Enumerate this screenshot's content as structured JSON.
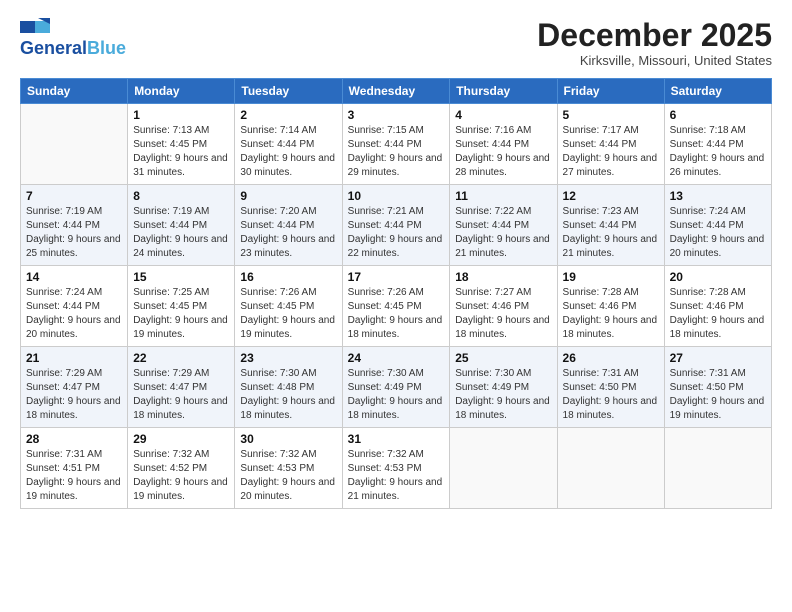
{
  "header": {
    "logo_line1": "General",
    "logo_line2": "Blue",
    "month": "December 2025",
    "location": "Kirksville, Missouri, United States"
  },
  "days_of_week": [
    "Sunday",
    "Monday",
    "Tuesday",
    "Wednesday",
    "Thursday",
    "Friday",
    "Saturday"
  ],
  "weeks": [
    [
      {
        "num": "",
        "sunrise": "",
        "sunset": "",
        "daylight": ""
      },
      {
        "num": "1",
        "sunrise": "Sunrise: 7:13 AM",
        "sunset": "Sunset: 4:45 PM",
        "daylight": "Daylight: 9 hours and 31 minutes."
      },
      {
        "num": "2",
        "sunrise": "Sunrise: 7:14 AM",
        "sunset": "Sunset: 4:44 PM",
        "daylight": "Daylight: 9 hours and 30 minutes."
      },
      {
        "num": "3",
        "sunrise": "Sunrise: 7:15 AM",
        "sunset": "Sunset: 4:44 PM",
        "daylight": "Daylight: 9 hours and 29 minutes."
      },
      {
        "num": "4",
        "sunrise": "Sunrise: 7:16 AM",
        "sunset": "Sunset: 4:44 PM",
        "daylight": "Daylight: 9 hours and 28 minutes."
      },
      {
        "num": "5",
        "sunrise": "Sunrise: 7:17 AM",
        "sunset": "Sunset: 4:44 PM",
        "daylight": "Daylight: 9 hours and 27 minutes."
      },
      {
        "num": "6",
        "sunrise": "Sunrise: 7:18 AM",
        "sunset": "Sunset: 4:44 PM",
        "daylight": "Daylight: 9 hours and 26 minutes."
      }
    ],
    [
      {
        "num": "7",
        "sunrise": "Sunrise: 7:19 AM",
        "sunset": "Sunset: 4:44 PM",
        "daylight": "Daylight: 9 hours and 25 minutes."
      },
      {
        "num": "8",
        "sunrise": "Sunrise: 7:19 AM",
        "sunset": "Sunset: 4:44 PM",
        "daylight": "Daylight: 9 hours and 24 minutes."
      },
      {
        "num": "9",
        "sunrise": "Sunrise: 7:20 AM",
        "sunset": "Sunset: 4:44 PM",
        "daylight": "Daylight: 9 hours and 23 minutes."
      },
      {
        "num": "10",
        "sunrise": "Sunrise: 7:21 AM",
        "sunset": "Sunset: 4:44 PM",
        "daylight": "Daylight: 9 hours and 22 minutes."
      },
      {
        "num": "11",
        "sunrise": "Sunrise: 7:22 AM",
        "sunset": "Sunset: 4:44 PM",
        "daylight": "Daylight: 9 hours and 21 minutes."
      },
      {
        "num": "12",
        "sunrise": "Sunrise: 7:23 AM",
        "sunset": "Sunset: 4:44 PM",
        "daylight": "Daylight: 9 hours and 21 minutes."
      },
      {
        "num": "13",
        "sunrise": "Sunrise: 7:24 AM",
        "sunset": "Sunset: 4:44 PM",
        "daylight": "Daylight: 9 hours and 20 minutes."
      }
    ],
    [
      {
        "num": "14",
        "sunrise": "Sunrise: 7:24 AM",
        "sunset": "Sunset: 4:44 PM",
        "daylight": "Daylight: 9 hours and 20 minutes."
      },
      {
        "num": "15",
        "sunrise": "Sunrise: 7:25 AM",
        "sunset": "Sunset: 4:45 PM",
        "daylight": "Daylight: 9 hours and 19 minutes."
      },
      {
        "num": "16",
        "sunrise": "Sunrise: 7:26 AM",
        "sunset": "Sunset: 4:45 PM",
        "daylight": "Daylight: 9 hours and 19 minutes."
      },
      {
        "num": "17",
        "sunrise": "Sunrise: 7:26 AM",
        "sunset": "Sunset: 4:45 PM",
        "daylight": "Daylight: 9 hours and 18 minutes."
      },
      {
        "num": "18",
        "sunrise": "Sunrise: 7:27 AM",
        "sunset": "Sunset: 4:46 PM",
        "daylight": "Daylight: 9 hours and 18 minutes."
      },
      {
        "num": "19",
        "sunrise": "Sunrise: 7:28 AM",
        "sunset": "Sunset: 4:46 PM",
        "daylight": "Daylight: 9 hours and 18 minutes."
      },
      {
        "num": "20",
        "sunrise": "Sunrise: 7:28 AM",
        "sunset": "Sunset: 4:46 PM",
        "daylight": "Daylight: 9 hours and 18 minutes."
      }
    ],
    [
      {
        "num": "21",
        "sunrise": "Sunrise: 7:29 AM",
        "sunset": "Sunset: 4:47 PM",
        "daylight": "Daylight: 9 hours and 18 minutes."
      },
      {
        "num": "22",
        "sunrise": "Sunrise: 7:29 AM",
        "sunset": "Sunset: 4:47 PM",
        "daylight": "Daylight: 9 hours and 18 minutes."
      },
      {
        "num": "23",
        "sunrise": "Sunrise: 7:30 AM",
        "sunset": "Sunset: 4:48 PM",
        "daylight": "Daylight: 9 hours and 18 minutes."
      },
      {
        "num": "24",
        "sunrise": "Sunrise: 7:30 AM",
        "sunset": "Sunset: 4:49 PM",
        "daylight": "Daylight: 9 hours and 18 minutes."
      },
      {
        "num": "25",
        "sunrise": "Sunrise: 7:30 AM",
        "sunset": "Sunset: 4:49 PM",
        "daylight": "Daylight: 9 hours and 18 minutes."
      },
      {
        "num": "26",
        "sunrise": "Sunrise: 7:31 AM",
        "sunset": "Sunset: 4:50 PM",
        "daylight": "Daylight: 9 hours and 18 minutes."
      },
      {
        "num": "27",
        "sunrise": "Sunrise: 7:31 AM",
        "sunset": "Sunset: 4:50 PM",
        "daylight": "Daylight: 9 hours and 19 minutes."
      }
    ],
    [
      {
        "num": "28",
        "sunrise": "Sunrise: 7:31 AM",
        "sunset": "Sunset: 4:51 PM",
        "daylight": "Daylight: 9 hours and 19 minutes."
      },
      {
        "num": "29",
        "sunrise": "Sunrise: 7:32 AM",
        "sunset": "Sunset: 4:52 PM",
        "daylight": "Daylight: 9 hours and 19 minutes."
      },
      {
        "num": "30",
        "sunrise": "Sunrise: 7:32 AM",
        "sunset": "Sunset: 4:53 PM",
        "daylight": "Daylight: 9 hours and 20 minutes."
      },
      {
        "num": "31",
        "sunrise": "Sunrise: 7:32 AM",
        "sunset": "Sunset: 4:53 PM",
        "daylight": "Daylight: 9 hours and 21 minutes."
      },
      {
        "num": "",
        "sunrise": "",
        "sunset": "",
        "daylight": ""
      },
      {
        "num": "",
        "sunrise": "",
        "sunset": "",
        "daylight": ""
      },
      {
        "num": "",
        "sunrise": "",
        "sunset": "",
        "daylight": ""
      }
    ]
  ]
}
